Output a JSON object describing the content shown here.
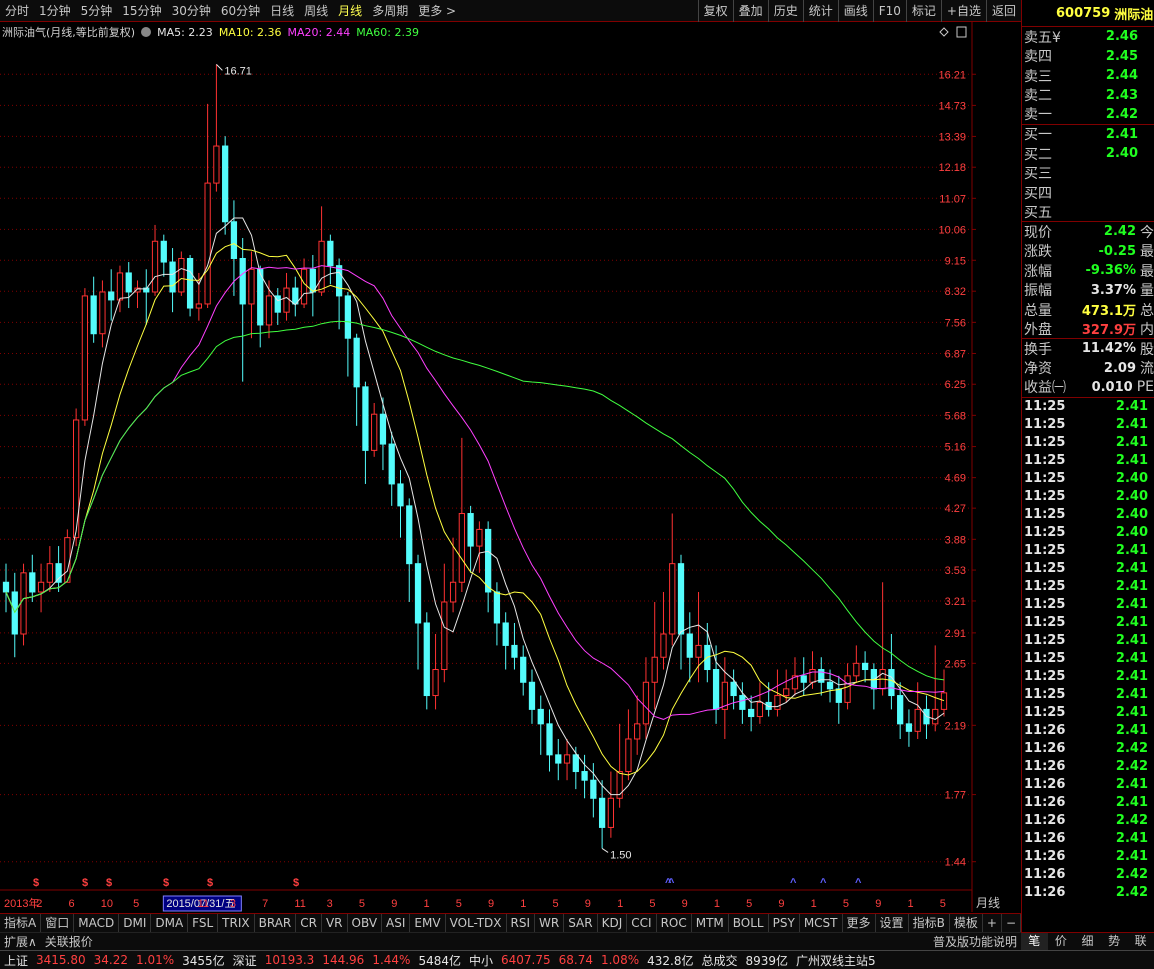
{
  "periods": [
    "分时",
    "1分钟",
    "5分钟",
    "15分钟",
    "30分钟",
    "60分钟",
    "日线",
    "周线",
    "月线",
    "多周期",
    "更多 >"
  ],
  "active_period": "月线",
  "toolbar_buttons": [
    "复权",
    "叠加",
    "历史",
    "统计",
    "画线",
    "F10",
    "标记",
    "+自选",
    "返回"
  ],
  "chart": {
    "title": "洲际油气(月线,等比前复权)",
    "ma_labels": [
      "MA5: 2.23",
      "MA10: 2.36",
      "MA20: 2.44",
      "MA60: 2.39"
    ],
    "period_label": "月线",
    "cursor_date": "2015/07/31/五",
    "high_label": "16.71",
    "low_label": "1.50",
    "colors": {
      "up": "#ff3232",
      "down": "#54fcfc",
      "ma5": "#e6e6e6",
      "ma10": "#ffff40",
      "ma20": "#ff40ff",
      "ma60": "#40ff40",
      "grid": "#800000",
      "axis_text": "#ff4040"
    }
  },
  "chart_data": {
    "type": "candlestick",
    "y_ticks": [
      16.21,
      14.73,
      13.39,
      12.18,
      11.07,
      10.06,
      9.15,
      8.32,
      7.56,
      6.87,
      6.25,
      5.68,
      5.16,
      4.69,
      4.27,
      3.88,
      3.53,
      3.21,
      2.91,
      2.65,
      2.19,
      1.77,
      1.44
    ],
    "y_range": [
      1.32,
      17.9
    ],
    "scale": "log",
    "x_labels": [
      "2013年",
      "2",
      "6",
      "10",
      "5",
      "2015/07/31/五",
      "11",
      "3",
      "7",
      "11",
      "3",
      "5",
      "9",
      "1",
      "5",
      "9",
      "1",
      "5",
      "9",
      "1",
      "5",
      "9",
      "1",
      "5",
      "9",
      "1",
      "5",
      "9",
      "1",
      "5"
    ],
    "markers": [
      "$",
      "$",
      "$",
      "$",
      "$",
      "$",
      "^",
      "^",
      "^",
      "^",
      "^"
    ],
    "candles": [
      [
        3.4,
        3.3,
        3.6,
        3.1
      ],
      [
        3.3,
        2.9,
        3.5,
        2.7
      ],
      [
        2.9,
        3.5,
        3.6,
        2.8
      ],
      [
        3.5,
        3.3,
        3.7,
        3.2
      ],
      [
        3.3,
        3.4,
        3.6,
        3.1
      ],
      [
        3.4,
        3.6,
        3.8,
        3.3
      ],
      [
        3.6,
        3.4,
        3.8,
        3.3
      ],
      [
        3.4,
        3.9,
        4.0,
        3.4
      ],
      [
        3.9,
        5.6,
        5.8,
        3.8
      ],
      [
        5.6,
        8.2,
        8.4,
        5.5
      ],
      [
        8.2,
        7.3,
        8.7,
        7.1
      ],
      [
        7.3,
        8.3,
        8.6,
        7.0
      ],
      [
        8.3,
        8.1,
        8.9,
        7.6
      ],
      [
        8.1,
        8.8,
        9.0,
        7.8
      ],
      [
        8.8,
        8.3,
        9.1,
        7.9
      ],
      [
        8.3,
        8.4,
        8.6,
        7.9
      ],
      [
        8.4,
        8.3,
        8.9,
        7.5
      ],
      [
        8.3,
        9.7,
        10.2,
        8.2
      ],
      [
        9.7,
        9.1,
        9.9,
        8.7
      ],
      [
        9.1,
        8.3,
        9.5,
        7.8
      ],
      [
        8.3,
        9.2,
        9.4,
        8.2
      ],
      [
        9.2,
        7.9,
        9.3,
        7.7
      ],
      [
        7.9,
        8.0,
        8.8,
        7.6
      ],
      [
        8.0,
        11.6,
        14.8,
        7.9
      ],
      [
        11.6,
        13.0,
        16.71,
        11.3
      ],
      [
        13.0,
        10.3,
        13.4,
        9.9
      ],
      [
        10.3,
        9.2,
        11.0,
        8.2
      ],
      [
        9.2,
        8.0,
        9.8,
        6.3
      ],
      [
        8.0,
        8.9,
        9.4,
        7.2
      ],
      [
        8.9,
        7.5,
        9.0,
        7.0
      ],
      [
        7.5,
        8.2,
        8.6,
        7.2
      ],
      [
        8.2,
        7.8,
        8.4,
        7.5
      ],
      [
        7.8,
        8.4,
        8.8,
        7.6
      ],
      [
        8.4,
        8.0,
        8.7,
        7.7
      ],
      [
        8.0,
        8.9,
        9.2,
        7.9
      ],
      [
        8.9,
        8.3,
        9.3,
        7.7
      ],
      [
        8.3,
        9.7,
        10.8,
        8.2
      ],
      [
        9.7,
        9.0,
        9.9,
        8.5
      ],
      [
        9.0,
        8.2,
        9.2,
        7.4
      ],
      [
        8.2,
        7.2,
        8.3,
        6.4
      ],
      [
        7.2,
        6.2,
        7.3,
        5.5
      ],
      [
        6.2,
        5.1,
        6.3,
        4.6
      ],
      [
        5.1,
        5.7,
        5.9,
        5.0
      ],
      [
        5.7,
        5.2,
        6.0,
        4.8
      ],
      [
        5.2,
        4.6,
        5.4,
        4.3
      ],
      [
        4.6,
        4.3,
        4.8,
        3.9
      ],
      [
        4.3,
        3.6,
        4.4,
        3.2
      ],
      [
        3.6,
        3.0,
        3.7,
        2.6
      ],
      [
        3.0,
        2.4,
        3.1,
        2.3
      ],
      [
        2.4,
        2.6,
        2.9,
        2.3
      ],
      [
        2.6,
        3.2,
        3.6,
        2.5
      ],
      [
        3.2,
        3.4,
        3.9,
        3.1
      ],
      [
        3.4,
        4.2,
        5.3,
        3.3
      ],
      [
        4.2,
        3.8,
        4.3,
        3.5
      ],
      [
        3.8,
        4.0,
        4.1,
        3.5
      ],
      [
        4.0,
        3.3,
        4.1,
        3.1
      ],
      [
        3.3,
        3.0,
        3.4,
        2.8
      ],
      [
        3.0,
        2.8,
        3.1,
        2.6
      ],
      [
        2.8,
        2.7,
        3.0,
        2.6
      ],
      [
        2.7,
        2.5,
        2.8,
        2.4
      ],
      [
        2.5,
        2.3,
        2.6,
        2.2
      ],
      [
        2.3,
        2.2,
        2.4,
        2.0
      ],
      [
        2.2,
        2.0,
        2.3,
        1.9
      ],
      [
        2.0,
        1.95,
        2.1,
        1.85
      ],
      [
        1.95,
        2.0,
        2.1,
        1.85
      ],
      [
        2.0,
        1.9,
        2.05,
        1.8
      ],
      [
        1.9,
        1.85,
        2.0,
        1.75
      ],
      [
        1.85,
        1.75,
        1.95,
        1.65
      ],
      [
        1.75,
        1.6,
        1.85,
        1.5
      ],
      [
        1.6,
        1.75,
        1.9,
        1.55
      ],
      [
        1.75,
        1.9,
        2.2,
        1.7
      ],
      [
        1.9,
        2.1,
        2.3,
        1.85
      ],
      [
        2.1,
        2.2,
        2.4,
        2.0
      ],
      [
        2.2,
        2.5,
        2.7,
        2.1
      ],
      [
        2.5,
        2.7,
        3.2,
        2.3
      ],
      [
        2.7,
        2.9,
        3.3,
        2.6
      ],
      [
        2.9,
        3.6,
        4.2,
        2.8
      ],
      [
        3.6,
        2.9,
        3.7,
        2.6
      ],
      [
        2.9,
        2.7,
        3.1,
        2.5
      ],
      [
        2.7,
        2.8,
        3.3,
        2.5
      ],
      [
        2.8,
        2.6,
        3.0,
        2.5
      ],
      [
        2.6,
        2.3,
        2.8,
        2.2
      ],
      [
        2.3,
        2.5,
        2.7,
        2.1
      ],
      [
        2.5,
        2.4,
        2.6,
        2.3
      ],
      [
        2.4,
        2.3,
        2.5,
        2.2
      ],
      [
        2.3,
        2.25,
        2.4,
        2.15
      ],
      [
        2.25,
        2.35,
        2.5,
        2.2
      ],
      [
        2.35,
        2.3,
        2.5,
        2.25
      ],
      [
        2.3,
        2.4,
        2.6,
        2.25
      ],
      [
        2.4,
        2.45,
        2.6,
        2.35
      ],
      [
        2.45,
        2.55,
        2.7,
        2.4
      ],
      [
        2.55,
        2.5,
        2.7,
        2.4
      ],
      [
        2.5,
        2.6,
        2.75,
        2.45
      ],
      [
        2.6,
        2.5,
        2.7,
        2.4
      ],
      [
        2.5,
        2.45,
        2.6,
        2.35
      ],
      [
        2.45,
        2.35,
        2.55,
        2.2
      ],
      [
        2.35,
        2.55,
        2.65,
        2.3
      ],
      [
        2.55,
        2.65,
        2.8,
        2.5
      ],
      [
        2.65,
        2.6,
        2.75,
        2.5
      ],
      [
        2.6,
        2.45,
        2.65,
        2.3
      ],
      [
        2.45,
        2.6,
        3.4,
        2.4
      ],
      [
        2.6,
        2.4,
        2.9,
        2.3
      ],
      [
        2.4,
        2.2,
        2.5,
        2.1
      ],
      [
        2.2,
        2.15,
        2.3,
        2.05
      ],
      [
        2.15,
        2.3,
        2.5,
        2.1
      ],
      [
        2.3,
        2.2,
        2.4,
        2.1
      ],
      [
        2.2,
        2.3,
        2.8,
        2.15
      ],
      [
        2.3,
        2.42,
        2.6,
        2.25
      ]
    ]
  },
  "indicators": [
    "指标A",
    "窗口",
    "MACD",
    "DMI",
    "DMA",
    "FSL",
    "TRIX",
    "BRAR",
    "CR",
    "VR",
    "OBV",
    "ASI",
    "EMV",
    "VOL-TDX",
    "RSI",
    "WR",
    "SAR",
    "KDJ",
    "CCI",
    "ROC",
    "MTM",
    "BOLL",
    "PSY",
    "MCST",
    "更多",
    "设置"
  ],
  "indicator_right": [
    "指标B",
    "模板",
    "+",
    "−"
  ],
  "ext": {
    "expand": "扩展∧",
    "related": "关联报价",
    "help": "普及版功能说明"
  },
  "quote": {
    "code": "600759",
    "name": "洲际油",
    "order_book": [
      {
        "label": "卖五",
        "sub": "¥",
        "price": "2.46"
      },
      {
        "label": "卖四",
        "sub": "",
        "price": "2.45"
      },
      {
        "label": "卖三",
        "sub": "",
        "price": "2.44"
      },
      {
        "label": "卖二",
        "sub": "",
        "price": "2.43"
      },
      {
        "label": "卖一",
        "sub": "",
        "price": "2.42"
      }
    ],
    "bids": [
      {
        "label": "买一",
        "price": "2.41"
      },
      {
        "label": "买二",
        "price": "2.40"
      },
      {
        "label": "买三",
        "price": ""
      },
      {
        "label": "买四",
        "price": ""
      },
      {
        "label": "买五",
        "price": ""
      }
    ],
    "stats": [
      {
        "label": "现价",
        "value": "2.42",
        "color": "green",
        "ext": "今"
      },
      {
        "label": "涨跌",
        "value": "-0.25",
        "color": "green",
        "ext": "最"
      },
      {
        "label": "涨幅",
        "value": "-9.36%",
        "color": "green",
        "ext": "最"
      },
      {
        "label": "振幅",
        "value": "3.37%",
        "color": "white",
        "ext": "量"
      },
      {
        "label": "总量",
        "value": "473.1万",
        "color": "yellow",
        "ext": "总"
      },
      {
        "label": "外盘",
        "value": "327.9万",
        "color": "red",
        "ext": "内"
      }
    ],
    "stats2": [
      {
        "label": "换手",
        "value": "11.42%",
        "color": "white",
        "ext": "股"
      },
      {
        "label": "净资",
        "value": "2.09",
        "color": "white",
        "ext": "流"
      },
      {
        "label": "收益㈠",
        "value": "0.010",
        "color": "white",
        "ext": "PE"
      }
    ],
    "ticks": [
      [
        "11:25",
        "2.41"
      ],
      [
        "11:25",
        "2.41"
      ],
      [
        "11:25",
        "2.41"
      ],
      [
        "11:25",
        "2.41"
      ],
      [
        "11:25",
        "2.40"
      ],
      [
        "11:25",
        "2.40"
      ],
      [
        "11:25",
        "2.40"
      ],
      [
        "11:25",
        "2.40"
      ],
      [
        "11:25",
        "2.41"
      ],
      [
        "11:25",
        "2.41"
      ],
      [
        "11:25",
        "2.41"
      ],
      [
        "11:25",
        "2.41"
      ],
      [
        "11:25",
        "2.41"
      ],
      [
        "11:25",
        "2.41"
      ],
      [
        "11:25",
        "2.41"
      ],
      [
        "11:25",
        "2.41"
      ],
      [
        "11:25",
        "2.41"
      ],
      [
        "11:25",
        "2.41"
      ],
      [
        "11:26",
        "2.41"
      ],
      [
        "11:26",
        "2.42"
      ],
      [
        "11:26",
        "2.42"
      ],
      [
        "11:26",
        "2.41"
      ],
      [
        "11:26",
        "2.41"
      ],
      [
        "11:26",
        "2.42"
      ],
      [
        "11:26",
        "2.41"
      ],
      [
        "11:26",
        "2.41"
      ],
      [
        "11:26",
        "2.42"
      ],
      [
        "11:26",
        "2.42"
      ]
    ],
    "tabs": [
      "笔",
      "价",
      "细",
      "势",
      "联"
    ]
  },
  "status": [
    {
      "text": "上证",
      "color": "white"
    },
    {
      "text": "3415.80",
      "color": "red"
    },
    {
      "text": "34.22",
      "color": "red"
    },
    {
      "text": "1.01%",
      "color": "red"
    },
    {
      "text": "3455亿",
      "color": "white"
    },
    {
      "text": "深证",
      "color": "white"
    },
    {
      "text": "10193.3",
      "color": "red"
    },
    {
      "text": "144.96",
      "color": "red"
    },
    {
      "text": "1.44%",
      "color": "red"
    },
    {
      "text": "5484亿",
      "color": "white"
    },
    {
      "text": "中小",
      "color": "white"
    },
    {
      "text": "6407.75",
      "color": "red"
    },
    {
      "text": "68.74",
      "color": "red"
    },
    {
      "text": "1.08%",
      "color": "red"
    },
    {
      "text": "432.8亿",
      "color": "white"
    },
    {
      "text": "总成交",
      "color": "white"
    },
    {
      "text": "8939亿",
      "color": "white"
    },
    {
      "text": "广州双线主站5",
      "color": "white"
    }
  ]
}
